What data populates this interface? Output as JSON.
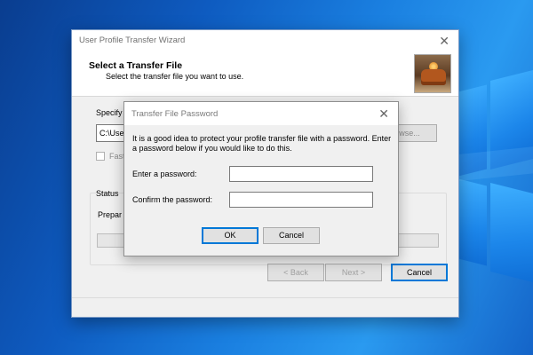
{
  "wizard": {
    "title": "User Profile Transfer Wizard",
    "heading": "Select a Transfer File",
    "subheading": "Select the transfer file you want to use.",
    "specify_label": "Specify",
    "path_value": "C:\\Use",
    "browse_label": "Browse...",
    "fast_label": "Fast",
    "status_label": "Status",
    "preparing_label": "Prepar",
    "progress": 0,
    "back_label": "< Back",
    "next_label": "Next >",
    "cancel_label": "Cancel"
  },
  "dialog": {
    "title": "Transfer File Password",
    "message": "It is a good idea to protect your profile transfer file with a password. Enter a password below if you would like to do this.",
    "password_label": "Enter a password:",
    "password_value": "",
    "confirm_label": "Confirm the password:",
    "confirm_value": "",
    "ok_label": "OK",
    "cancel_label": "Cancel"
  },
  "icons": {
    "close": "close-icon",
    "header_image": "wizard-header-image"
  },
  "colors": {
    "desktop": "#1a7fe0",
    "window_bg": "#f0f0f0",
    "focus_accent": "#0078d7"
  }
}
